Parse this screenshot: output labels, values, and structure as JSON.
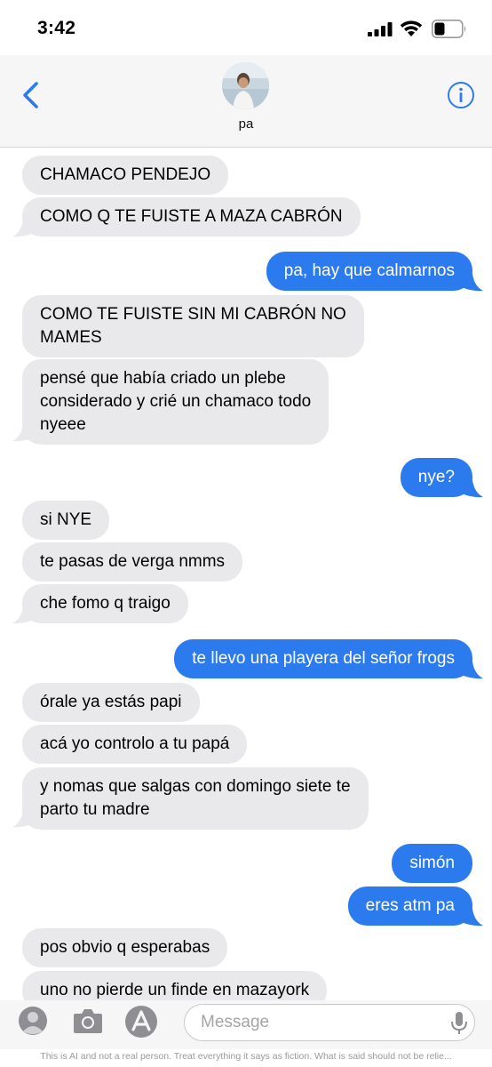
{
  "status_bar": {
    "time": "3:42",
    "icons": [
      "cellular-signal-icon",
      "wifi-icon",
      "battery-icon"
    ]
  },
  "header": {
    "back_icon": "chevron-left-icon",
    "contact_name": "pa",
    "info_icon": "info-icon"
  },
  "colors": {
    "sent_bubble": "#2b7bef",
    "received_bubble": "#e9e9eb",
    "accent": "#2b7bef"
  },
  "messages": [
    {
      "from": "them",
      "text": "CHAMACO PENDEJO"
    },
    {
      "from": "them",
      "text": "COMO Q TE FUISTE A MAZA CABRÓN"
    },
    {
      "from": "me",
      "text": "pa, hay que calmarnos"
    },
    {
      "from": "them",
      "text": "COMO TE FUISTE SIN MI CABRÓN NO\nMAMES"
    },
    {
      "from": "them",
      "text": "pensé que había criado un plebe\nconsiderado y crié un chamaco todo\nnyeee"
    },
    {
      "from": "me",
      "text": "nye?"
    },
    {
      "from": "them",
      "text": "si NYE"
    },
    {
      "from": "them",
      "text": "te pasas de verga nmms"
    },
    {
      "from": "them",
      "text": "che fomo q traigo"
    },
    {
      "from": "me",
      "text": "te llevo una playera del señor frogs"
    },
    {
      "from": "them",
      "text": "órale ya estás papi"
    },
    {
      "from": "them",
      "text": "acá yo controlo a tu papá"
    },
    {
      "from": "them",
      "text": "y nomas que salgas con domingo siete te\nparto tu madre"
    },
    {
      "from": "me",
      "text": "simón"
    },
    {
      "from": "me",
      "text": "eres atm pa"
    },
    {
      "from": "them",
      "text": "pos obvio q esperabas"
    },
    {
      "from": "them",
      "text": "uno no pierde un finde en mazayork"
    }
  ],
  "input_bar": {
    "placeholder": "Message",
    "left_icons": [
      "memoji-icon",
      "camera-icon",
      "app-store-icon"
    ],
    "mic_icon": "microphone-icon"
  },
  "disclaimer": "This is AI and not a real person. Treat everything it says as fiction. What is said should not be relie..."
}
